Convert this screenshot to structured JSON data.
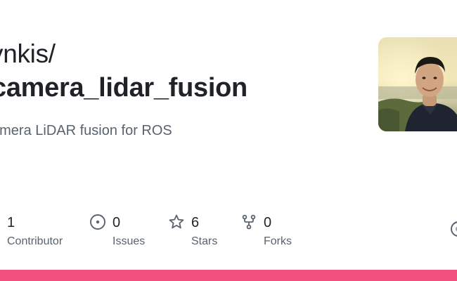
{
  "repo_card": {
    "owner": "ynkis/",
    "name": "camera_lidar_fusion",
    "description": "amera LiDAR fusion for ROS"
  },
  "stats": [
    {
      "icon": "people-icon",
      "count": "1",
      "label": "Contributor"
    },
    {
      "icon": "issue-circle-icon",
      "count": "0",
      "label": "Issues"
    },
    {
      "icon": "star-icon",
      "count": "6",
      "label": "Stars"
    },
    {
      "icon": "fork-icon",
      "count": "0",
      "label": "Forks"
    }
  ],
  "colors": {
    "accent_bar": "#f0507e",
    "text_primary": "#1f2328",
    "text_secondary": "#59636e"
  }
}
